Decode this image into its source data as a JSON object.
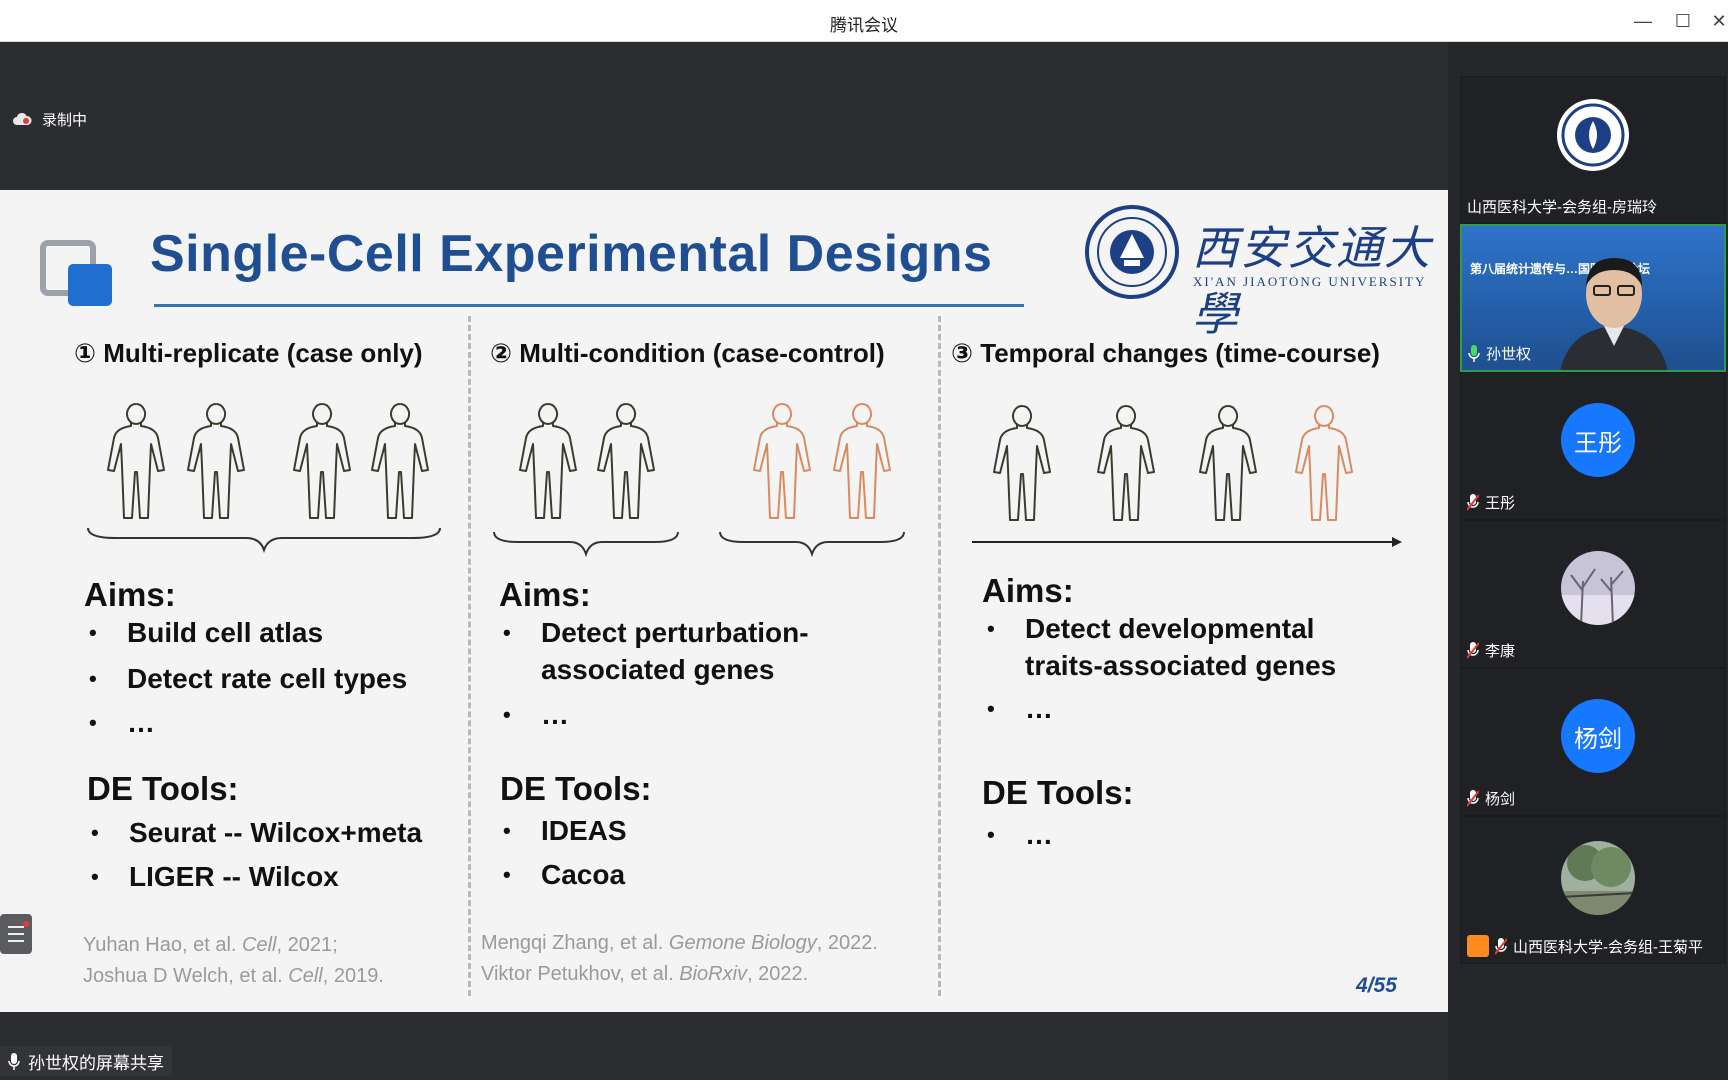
{
  "app": {
    "window_title": "腾讯会议"
  },
  "recording": {
    "label": "录制中"
  },
  "slide": {
    "title": "Single-Cell Experimental Designs",
    "university_cn": "西安交通大學",
    "university_en": "XI'AN JIAOTONG UNIVERSITY",
    "page": "4/55",
    "columns": [
      {
        "heading": "① Multi-replicate (case only)",
        "aims_label": "Aims:",
        "aims": [
          "Build cell atlas",
          "Detect rate cell types",
          "…"
        ],
        "tools_label": "DE Tools:",
        "tools": [
          "Seurat -- Wilcox+meta",
          "LIGER -- Wilcox"
        ],
        "citations": [
          {
            "authors": "Yuhan Hao, et al. ",
            "journal": "Cell",
            "year": ", 2021;"
          },
          {
            "authors": "Joshua D Welch, et al. ",
            "journal": "Cell",
            "year": ", 2019."
          }
        ]
      },
      {
        "heading": "② Multi-condition (case-control)",
        "aims_label": "Aims:",
        "aims": [
          "Detect perturbation-associated genes",
          "…"
        ],
        "tools_label": "DE Tools:",
        "tools": [
          "IDEAS",
          "Cacoa"
        ],
        "citations": [
          {
            "authors": "Mengqi Zhang, et al. ",
            "journal": "Gemone Biology",
            "year": ", 2022."
          },
          {
            "authors": "Viktor Petukhov, et al. ",
            "journal": "BioRxiv",
            "year": ", 2022."
          }
        ]
      },
      {
        "heading": "③ Temporal changes (time-course)",
        "aims_label": "Aims:",
        "aims": [
          "Detect developmental traits-associated genes",
          "…"
        ],
        "tools_label": "DE Tools:",
        "tools": [
          "…"
        ]
      }
    ]
  },
  "colors": {
    "slide_title": "#1f4f92",
    "figure_dark": "#3b3b2e",
    "figure_orange": "#d98a62",
    "active_speaker": "#2d9c4e",
    "avatar_blue": "#1677ff"
  },
  "participants": [
    {
      "name": "山西医科大学-会务组-房瑞玲",
      "avatar": "university-logo"
    },
    {
      "name": "孙世权",
      "video": true,
      "banner": "第八届统计遗传与…国际高峰论坛"
    },
    {
      "name": "王彤",
      "initials": "王彤"
    },
    {
      "name": "李康",
      "avatar": "photo-tree"
    },
    {
      "name": "杨剑",
      "initials": "杨剑"
    },
    {
      "name": "山西医科大学-会务组-王菊平",
      "avatar": "photo-park"
    }
  ],
  "screen_share": {
    "label": "孙世权的屏幕共享"
  }
}
